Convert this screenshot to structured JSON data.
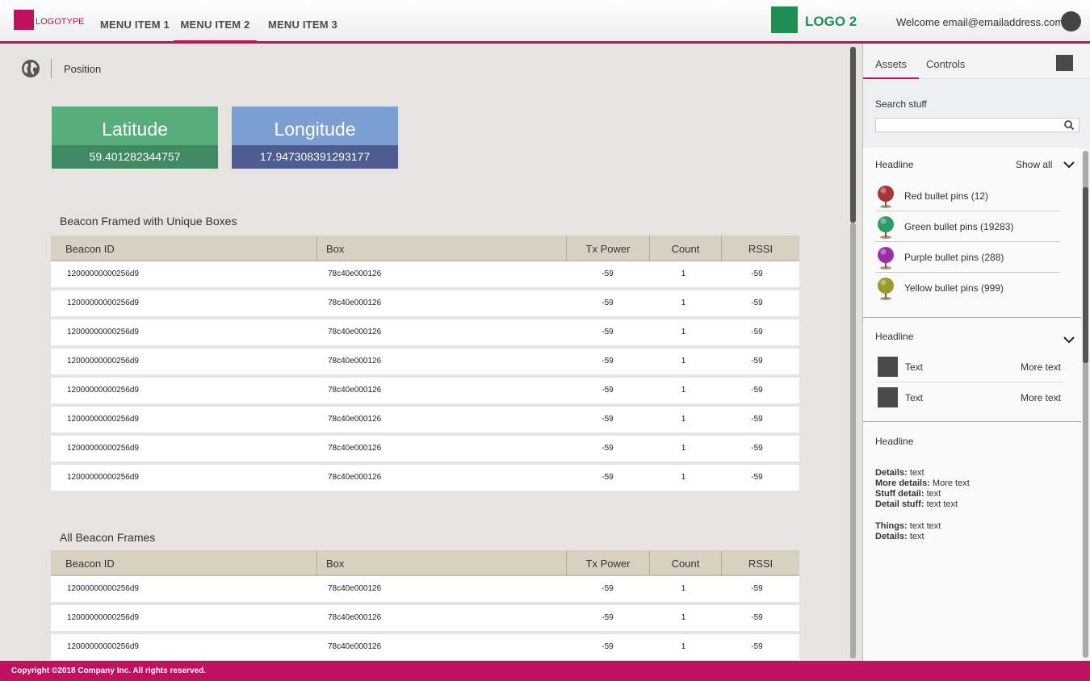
{
  "header": {
    "logo_text": "LOGOTYPE",
    "menu": [
      "MENU ITEM 1",
      "MENU ITEM 2",
      "MENU ITEM 3"
    ],
    "active_menu": "MENU ITEM 2",
    "logo2_text": "LOGO 2",
    "welcome": "Welcome email@emailaddress.com"
  },
  "colors": {
    "brand": "#c0115f",
    "logo2": "#1e8f54",
    "latitude": "#57ad7b",
    "longitude": "#7b9fd1"
  },
  "position": {
    "label": "Position",
    "icon": "globe-icon",
    "latitude": {
      "title": "Latitude",
      "value": "59.401282344757"
    },
    "longitude": {
      "title": "Longitude",
      "value": "17.947308391293177"
    }
  },
  "table_columns": [
    "Beacon ID",
    "Box",
    "Tx Power",
    "Count",
    "RSSI"
  ],
  "table1": {
    "title": "Beacon Framed with Unique Boxes",
    "rows": [
      [
        "12000000000256d9",
        "78c40e000126",
        "-59",
        "1",
        "-59"
      ],
      [
        "12000000000256d9",
        "78c40e000126",
        "-59",
        "1",
        "-59"
      ],
      [
        "12000000000256d9",
        "78c40e000126",
        "-59",
        "1",
        "-59"
      ],
      [
        "12000000000256d9",
        "78c40e000126",
        "-59",
        "1",
        "-59"
      ],
      [
        "12000000000256d9",
        "78c40e000126",
        "-59",
        "1",
        "-59"
      ],
      [
        "12000000000256d9",
        "78c40e000126",
        "-59",
        "1",
        "-59"
      ],
      [
        "12000000000256d9",
        "78c40e000126",
        "-59",
        "1",
        "-59"
      ],
      [
        "12000000000256d9",
        "78c40e000126",
        "-59",
        "1",
        "-59"
      ]
    ]
  },
  "table2": {
    "title": "All Beacon Frames",
    "rows": [
      [
        "12000000000256d9",
        "78c40e000126",
        "-59",
        "1",
        "-59"
      ],
      [
        "12000000000256d9",
        "78c40e000126",
        "-59",
        "1",
        "-59"
      ],
      [
        "12000000000256d9",
        "78c40e000126",
        "-59",
        "1",
        "-59"
      ]
    ]
  },
  "panel": {
    "tabs": [
      "Assets",
      "Controls"
    ],
    "active_tab": "Assets",
    "search_label": "Search stuff",
    "search_value": "",
    "group1": {
      "headline": "Headline",
      "show_all": "Show all",
      "pins": [
        {
          "label": "Red bullet pins (12)",
          "color": "#a8333a"
        },
        {
          "label": "Green bullet pins (19283)",
          "color": "#2e9c68"
        },
        {
          "label": "Purple bullet pins (288)",
          "color": "#9b2ea8"
        },
        {
          "label": "Yellow bullet pins (999)",
          "color": "#9a9a2e"
        }
      ]
    },
    "group2": {
      "headline": "Headline",
      "rows": [
        {
          "a": "Text",
          "b": "More text"
        },
        {
          "a": "Text",
          "b": "More text"
        }
      ]
    },
    "group3": {
      "headline": "Headline",
      "details": [
        {
          "k": "Details:",
          "v": "text"
        },
        {
          "k": "More details:",
          "v": "More text"
        },
        {
          "k": "Stuff detail:",
          "v": "text"
        },
        {
          "k": "Detail stuff:",
          "v": "text text"
        },
        {
          "k": "Things:",
          "v": "text text"
        },
        {
          "k": "Details:",
          "v": "text"
        }
      ]
    }
  },
  "footer": {
    "copyright": "Copyright ©2018 Company Inc. All rights reserved."
  }
}
